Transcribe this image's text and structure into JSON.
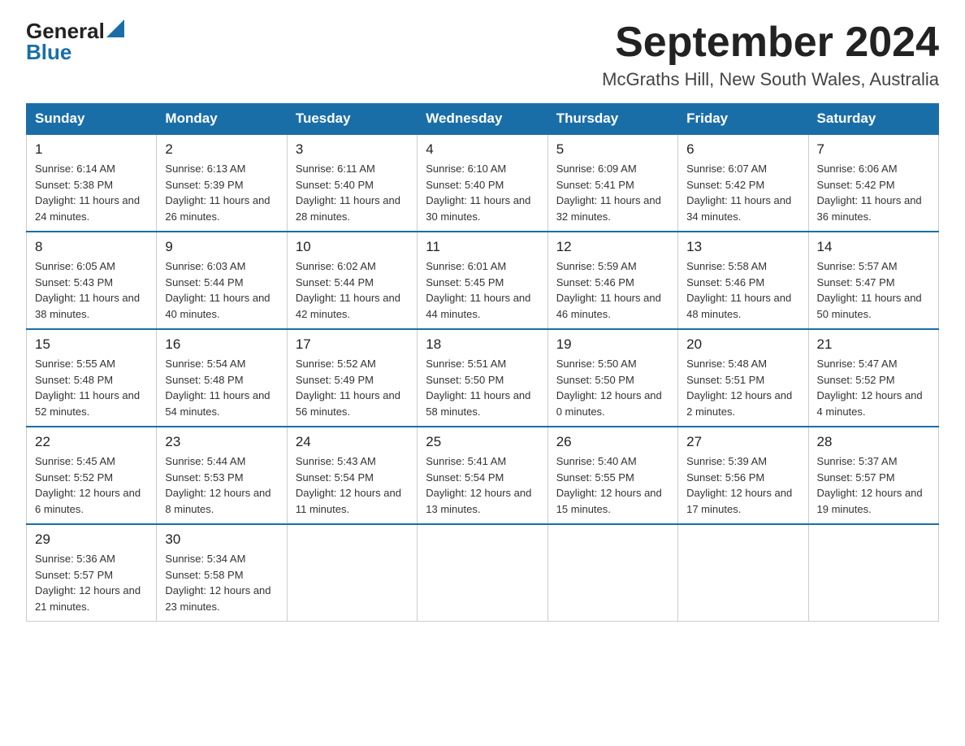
{
  "logo": {
    "general": "General",
    "blue": "Blue",
    "triangle": "▲"
  },
  "title": "September 2024",
  "location": "McGraths Hill, New South Wales, Australia",
  "days_of_week": [
    "Sunday",
    "Monday",
    "Tuesday",
    "Wednesday",
    "Thursday",
    "Friday",
    "Saturday"
  ],
  "weeks": [
    [
      {
        "day": "1",
        "sunrise": "6:14 AM",
        "sunset": "5:38 PM",
        "daylight": "11 hours and 24 minutes."
      },
      {
        "day": "2",
        "sunrise": "6:13 AM",
        "sunset": "5:39 PM",
        "daylight": "11 hours and 26 minutes."
      },
      {
        "day": "3",
        "sunrise": "6:11 AM",
        "sunset": "5:40 PM",
        "daylight": "11 hours and 28 minutes."
      },
      {
        "day": "4",
        "sunrise": "6:10 AM",
        "sunset": "5:40 PM",
        "daylight": "11 hours and 30 minutes."
      },
      {
        "day": "5",
        "sunrise": "6:09 AM",
        "sunset": "5:41 PM",
        "daylight": "11 hours and 32 minutes."
      },
      {
        "day": "6",
        "sunrise": "6:07 AM",
        "sunset": "5:42 PM",
        "daylight": "11 hours and 34 minutes."
      },
      {
        "day": "7",
        "sunrise": "6:06 AM",
        "sunset": "5:42 PM",
        "daylight": "11 hours and 36 minutes."
      }
    ],
    [
      {
        "day": "8",
        "sunrise": "6:05 AM",
        "sunset": "5:43 PM",
        "daylight": "11 hours and 38 minutes."
      },
      {
        "day": "9",
        "sunrise": "6:03 AM",
        "sunset": "5:44 PM",
        "daylight": "11 hours and 40 minutes."
      },
      {
        "day": "10",
        "sunrise": "6:02 AM",
        "sunset": "5:44 PM",
        "daylight": "11 hours and 42 minutes."
      },
      {
        "day": "11",
        "sunrise": "6:01 AM",
        "sunset": "5:45 PM",
        "daylight": "11 hours and 44 minutes."
      },
      {
        "day": "12",
        "sunrise": "5:59 AM",
        "sunset": "5:46 PM",
        "daylight": "11 hours and 46 minutes."
      },
      {
        "day": "13",
        "sunrise": "5:58 AM",
        "sunset": "5:46 PM",
        "daylight": "11 hours and 48 minutes."
      },
      {
        "day": "14",
        "sunrise": "5:57 AM",
        "sunset": "5:47 PM",
        "daylight": "11 hours and 50 minutes."
      }
    ],
    [
      {
        "day": "15",
        "sunrise": "5:55 AM",
        "sunset": "5:48 PM",
        "daylight": "11 hours and 52 minutes."
      },
      {
        "day": "16",
        "sunrise": "5:54 AM",
        "sunset": "5:48 PM",
        "daylight": "11 hours and 54 minutes."
      },
      {
        "day": "17",
        "sunrise": "5:52 AM",
        "sunset": "5:49 PM",
        "daylight": "11 hours and 56 minutes."
      },
      {
        "day": "18",
        "sunrise": "5:51 AM",
        "sunset": "5:50 PM",
        "daylight": "11 hours and 58 minutes."
      },
      {
        "day": "19",
        "sunrise": "5:50 AM",
        "sunset": "5:50 PM",
        "daylight": "12 hours and 0 minutes."
      },
      {
        "day": "20",
        "sunrise": "5:48 AM",
        "sunset": "5:51 PM",
        "daylight": "12 hours and 2 minutes."
      },
      {
        "day": "21",
        "sunrise": "5:47 AM",
        "sunset": "5:52 PM",
        "daylight": "12 hours and 4 minutes."
      }
    ],
    [
      {
        "day": "22",
        "sunrise": "5:45 AM",
        "sunset": "5:52 PM",
        "daylight": "12 hours and 6 minutes."
      },
      {
        "day": "23",
        "sunrise": "5:44 AM",
        "sunset": "5:53 PM",
        "daylight": "12 hours and 8 minutes."
      },
      {
        "day": "24",
        "sunrise": "5:43 AM",
        "sunset": "5:54 PM",
        "daylight": "12 hours and 11 minutes."
      },
      {
        "day": "25",
        "sunrise": "5:41 AM",
        "sunset": "5:54 PM",
        "daylight": "12 hours and 13 minutes."
      },
      {
        "day": "26",
        "sunrise": "5:40 AM",
        "sunset": "5:55 PM",
        "daylight": "12 hours and 15 minutes."
      },
      {
        "day": "27",
        "sunrise": "5:39 AM",
        "sunset": "5:56 PM",
        "daylight": "12 hours and 17 minutes."
      },
      {
        "day": "28",
        "sunrise": "5:37 AM",
        "sunset": "5:57 PM",
        "daylight": "12 hours and 19 minutes."
      }
    ],
    [
      {
        "day": "29",
        "sunrise": "5:36 AM",
        "sunset": "5:57 PM",
        "daylight": "12 hours and 21 minutes."
      },
      {
        "day": "30",
        "sunrise": "5:34 AM",
        "sunset": "5:58 PM",
        "daylight": "12 hours and 23 minutes."
      },
      null,
      null,
      null,
      null,
      null
    ]
  ],
  "labels": {
    "sunrise": "Sunrise:",
    "sunset": "Sunset:",
    "daylight": "Daylight:"
  }
}
